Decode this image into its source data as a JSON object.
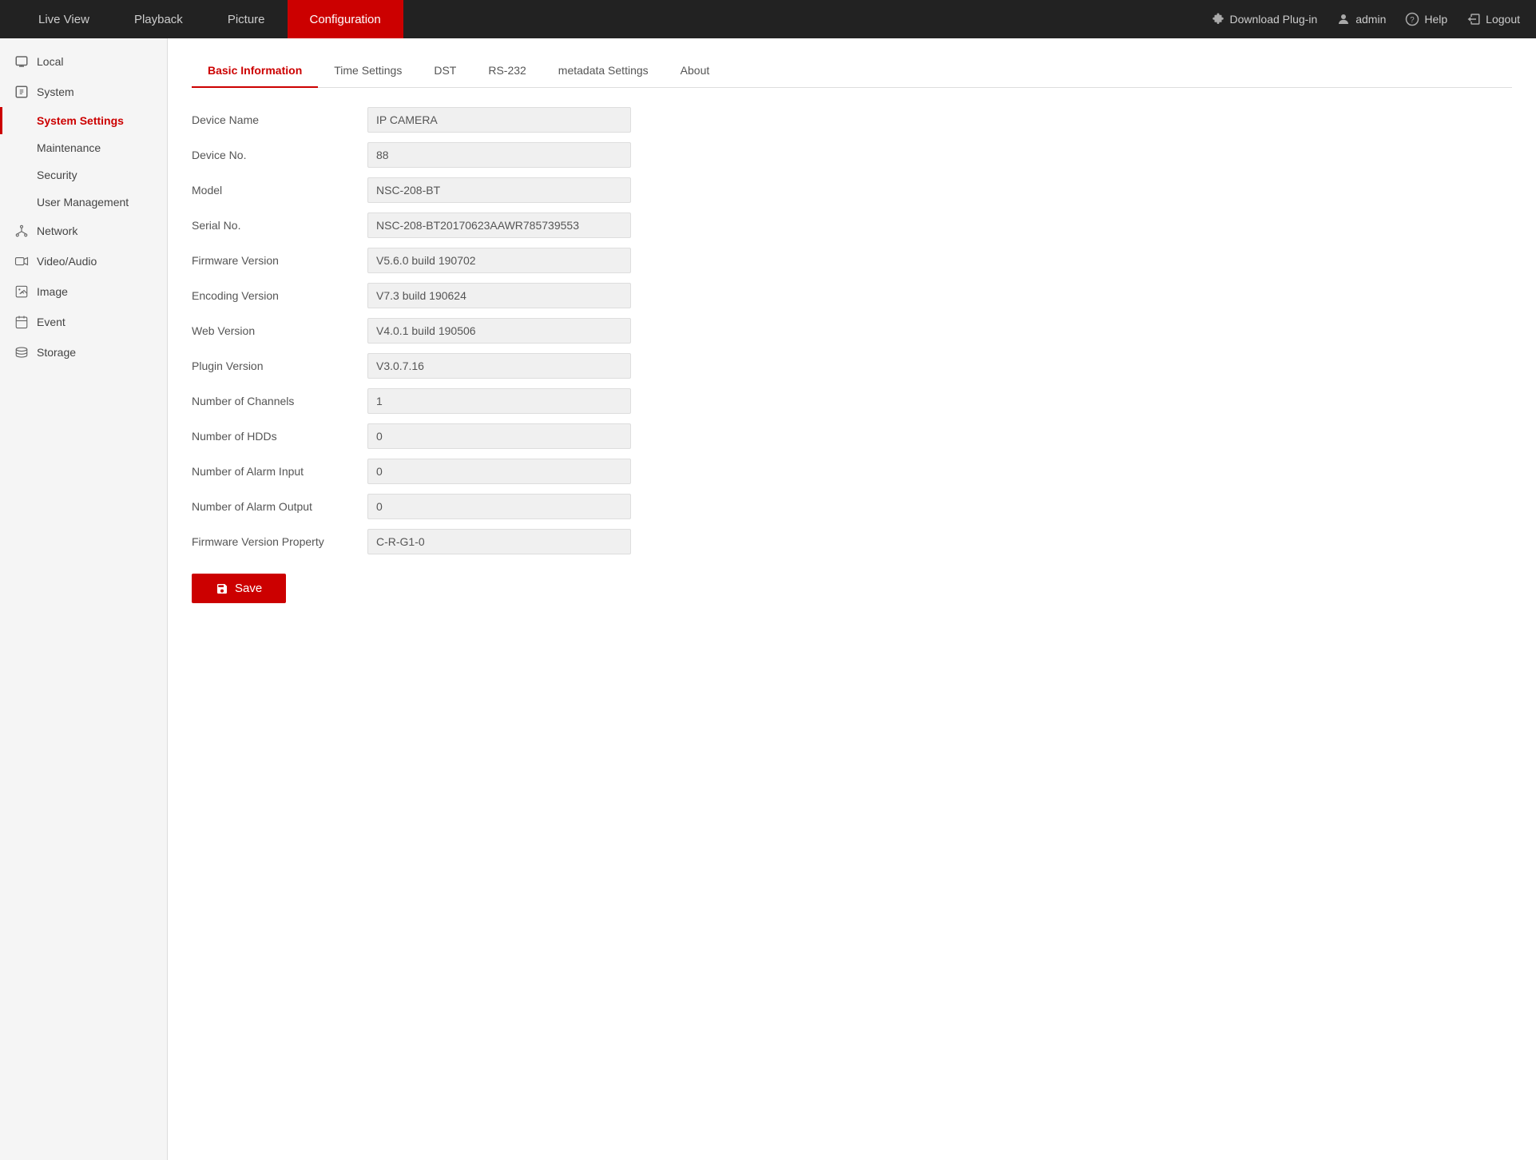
{
  "topnav": {
    "items": [
      {
        "label": "Live View",
        "active": false
      },
      {
        "label": "Playback",
        "active": false
      },
      {
        "label": "Picture",
        "active": false
      },
      {
        "label": "Configuration",
        "active": true
      }
    ],
    "right": [
      {
        "label": "Download Plug-in",
        "icon": "plugin-icon"
      },
      {
        "label": "admin",
        "icon": "user-icon"
      },
      {
        "label": "Help",
        "icon": "help-icon"
      },
      {
        "label": "Logout",
        "icon": "logout-icon"
      }
    ]
  },
  "sidebar": {
    "sections": [
      {
        "items": [
          {
            "label": "Local",
            "icon": "local-icon",
            "sub": false,
            "active": false
          },
          {
            "label": "System",
            "icon": "system-icon",
            "sub": false,
            "active": false
          },
          {
            "label": "System Settings",
            "sub": true,
            "active": true
          },
          {
            "label": "Maintenance",
            "sub": true,
            "active": false
          },
          {
            "label": "Security",
            "sub": true,
            "active": false
          },
          {
            "label": "User Management",
            "sub": true,
            "active": false
          },
          {
            "label": "Network",
            "icon": "network-icon",
            "sub": false,
            "active": false
          },
          {
            "label": "Video/Audio",
            "icon": "video-icon",
            "sub": false,
            "active": false
          },
          {
            "label": "Image",
            "icon": "image-icon",
            "sub": false,
            "active": false
          },
          {
            "label": "Event",
            "icon": "event-icon",
            "sub": false,
            "active": false
          },
          {
            "label": "Storage",
            "icon": "storage-icon",
            "sub": false,
            "active": false
          }
        ]
      }
    ]
  },
  "tabs": [
    {
      "label": "Basic Information",
      "active": true
    },
    {
      "label": "Time Settings",
      "active": false
    },
    {
      "label": "DST",
      "active": false
    },
    {
      "label": "RS-232",
      "active": false
    },
    {
      "label": "metadata Settings",
      "active": false
    },
    {
      "label": "About",
      "active": false
    }
  ],
  "form": {
    "fields": [
      {
        "label": "Device Name",
        "value": "IP CAMERA"
      },
      {
        "label": "Device No.",
        "value": "88"
      },
      {
        "label": "Model",
        "value": "NSC-208-BT"
      },
      {
        "label": "Serial No.",
        "value": "NSC-208-BT20170623AAWR785739553"
      },
      {
        "label": "Firmware Version",
        "value": "V5.6.0 build 190702"
      },
      {
        "label": "Encoding Version",
        "value": "V7.3 build 190624"
      },
      {
        "label": "Web Version",
        "value": "V4.0.1 build 190506"
      },
      {
        "label": "Plugin Version",
        "value": "V3.0.7.16"
      },
      {
        "label": "Number of Channels",
        "value": "1"
      },
      {
        "label": "Number of HDDs",
        "value": "0"
      },
      {
        "label": "Number of Alarm Input",
        "value": "0"
      },
      {
        "label": "Number of Alarm Output",
        "value": "0"
      },
      {
        "label": "Firmware Version Property",
        "value": "C-R-G1-0"
      }
    ]
  },
  "save_button": "Save"
}
